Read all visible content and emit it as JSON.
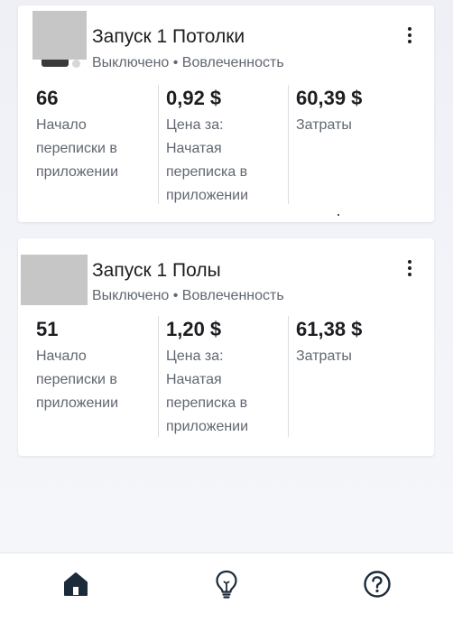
{
  "campaigns": [
    {
      "title": "Запуск 1  Потолки",
      "status": "Выключено • Вовлеченность",
      "metrics": [
        {
          "value": "66",
          "label": "Начало переписки в приложении"
        },
        {
          "value": "0,92 $",
          "label": "Цена за: Начатая переписка в приложении"
        },
        {
          "value": "60,39 $",
          "label": "Затраты"
        }
      ]
    },
    {
      "title": "Запуск 1 Полы",
      "status": "Выключено • Вовлеченность",
      "metrics": [
        {
          "value": "51",
          "label": "Начало переписки в приложении"
        },
        {
          "value": "1,20 $",
          "label": "Цена за: Начатая переписка в приложении"
        },
        {
          "value": "61,38 $",
          "label": "Затраты"
        }
      ]
    }
  ],
  "icons": {
    "more": "more-vertical-icon",
    "home": "home-icon",
    "ideas": "lightbulb-icon",
    "help": "question-circle-icon"
  },
  "colors": {
    "text_primary": "#1c1e21",
    "text_secondary": "#606770",
    "thumbnail_placeholder": "#c6c6c6"
  }
}
